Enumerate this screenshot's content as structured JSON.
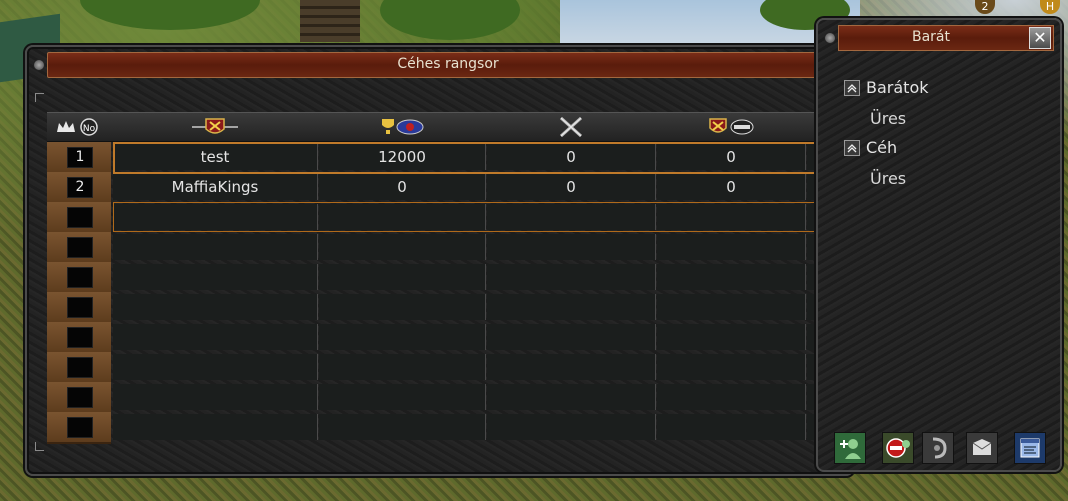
{
  "ranking_window": {
    "title": "Céhes rangsor",
    "rows": [
      {
        "rank": "1",
        "name": "test",
        "score": "12000",
        "c3": "0",
        "c4": "0"
      },
      {
        "rank": "2",
        "name": "MaffiaKings",
        "score": "0",
        "c3": "0",
        "c4": "0"
      },
      {
        "rank": "",
        "name": "",
        "score": "",
        "c3": "",
        "c4": ""
      },
      {
        "rank": "",
        "name": "",
        "score": "",
        "c3": "",
        "c4": ""
      },
      {
        "rank": "",
        "name": "",
        "score": "",
        "c3": "",
        "c4": ""
      },
      {
        "rank": "",
        "name": "",
        "score": "",
        "c3": "",
        "c4": ""
      },
      {
        "rank": "",
        "name": "",
        "score": "",
        "c3": "",
        "c4": ""
      },
      {
        "rank": "",
        "name": "",
        "score": "",
        "c3": "",
        "c4": ""
      },
      {
        "rank": "",
        "name": "",
        "score": "",
        "c3": "",
        "c4": ""
      },
      {
        "rank": "",
        "name": "",
        "score": "",
        "c3": "",
        "c4": ""
      }
    ],
    "header_icons": [
      "crown-number-icon",
      "guild-emblem-icon",
      "trophy-icon",
      "crossed-swords-icon",
      "shield-defense-icon"
    ],
    "selected_row": 0
  },
  "friend_window": {
    "title": "Barát",
    "groups": [
      {
        "label": "Barátok",
        "empty_text": "Üres"
      },
      {
        "label": "Céh",
        "empty_text": "Üres"
      }
    ],
    "toolbar_icons": [
      "add-friend-icon",
      "block-icon",
      "whisper-icon",
      "mail-icon",
      "settings-window-icon"
    ]
  },
  "hud": {
    "badge_left": "2",
    "badge_right": "H"
  }
}
